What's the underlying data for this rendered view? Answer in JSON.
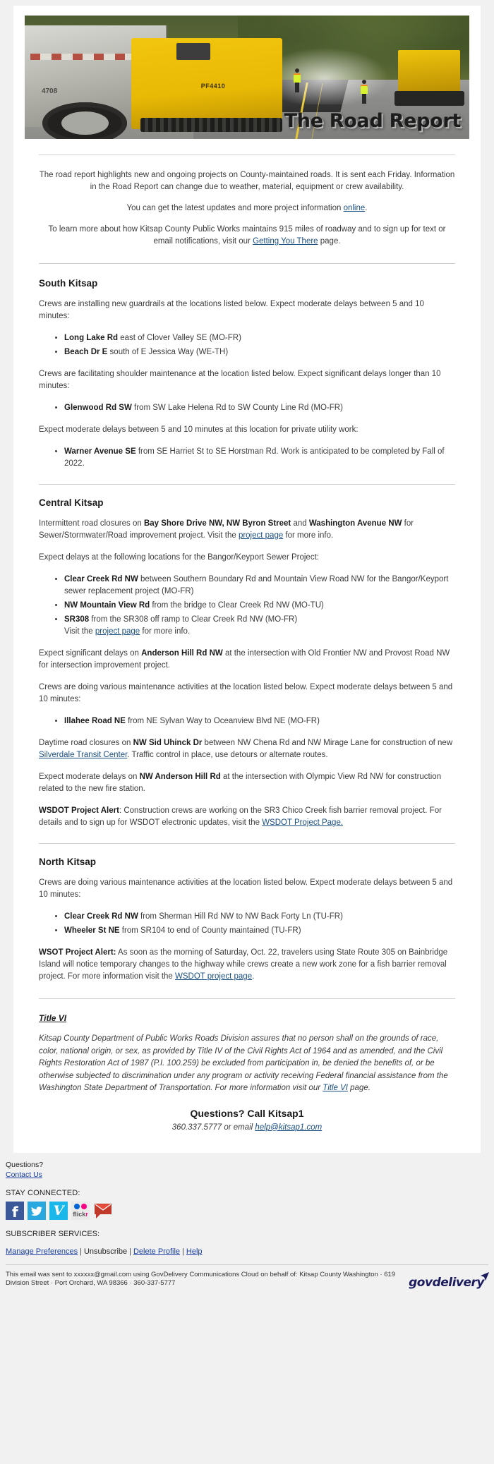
{
  "header": {
    "banner_title": "The Road Report",
    "paver_label": "PF4410",
    "truck_number": "4708"
  },
  "intro": {
    "line1": "The road report highlights new and ongoing projects on County-maintained roads. It is sent each Friday. Information in the Road Report can change due to weather, material, equipment or crew availability.",
    "line2_pre": "You can get the latest updates and more project information ",
    "line2_link": "online",
    "line2_post": ".",
    "line3_pre": "To learn more about how Kitsap County Public Works maintains 915 miles of roadway and to sign up for text or email notifications, visit our ",
    "line3_link": "Getting You There",
    "line3_post": " page."
  },
  "south_kitsap": {
    "heading": "South Kitsap",
    "p1": "Crews are installing new guardrails at the locations listed below. Expect moderate delays between 5 and 10 minutes:",
    "list1": [
      {
        "road": "Long Lake Rd",
        "rest": " east of Clover Valley SE (MO-FR)"
      },
      {
        "road": "Beach Dr E",
        "rest": " south of E Jessica Way (WE-TH)"
      }
    ],
    "p2": "Crews are facilitating shoulder maintenance at the location listed below. Expect significant delays longer than 10 minutes:",
    "list2": [
      {
        "road": "Glenwood Rd SW",
        "rest": " from SW Lake Helena Rd to SW County Line Rd (MO-FR)"
      }
    ],
    "p3": "Expect moderate delays between 5 and 10 minutes at this location for private utility work:",
    "list3": [
      {
        "road": "Warner Avenue SE",
        "rest": " from SE Harriet St to SE Horstman Rd. Work is anticipated to be completed by Fall of 2022."
      }
    ]
  },
  "central_kitsap": {
    "heading": "Central Kitsap",
    "p1_a": "Intermittent road closures on ",
    "p1_b1": "Bay Shore Drive NW, NW Byron Street",
    "p1_c": " and ",
    "p1_b2": "Washington Avenue NW",
    "p1_d": " for Sewer/Stormwater/Road improvement project. Visit the ",
    "p1_link": "project page",
    "p1_e": " for more info.",
    "p2": "Expect delays at the following locations for the Bangor/Keyport Sewer Project:",
    "list1": [
      {
        "road": "Clear Creek Rd NW",
        "rest": " between Southern Boundary Rd and Mountain View Road NW for the Bangor/Keyport sewer replacement project (MO-FR)"
      },
      {
        "road": "NW Mountain View Rd",
        "rest": " from the bridge to Clear Creek Rd NW (MO-TU)"
      },
      {
        "road": "SR308",
        "rest": " from the SR308 off ramp to Clear Creek Rd NW (MO-FR)"
      }
    ],
    "list1_sub_pre": "Visit the ",
    "list1_sub_link": "project page",
    "list1_sub_post": " for more info.",
    "p3_a": "Expect significant delays on ",
    "p3_b": "Anderson Hill Rd NW",
    "p3_c": " at the intersection with Old Frontier NW and Provost Road NW for intersection improvement project.",
    "p4": "Crews are doing various maintenance activities at the location listed below. Expect moderate delays between 5 and 10 minutes:",
    "list2": [
      {
        "road": "Illahee Road NE",
        "rest": " from NE Sylvan Way to Oceanview Blvd NE (MO-FR)"
      }
    ],
    "p5_a": "Daytime road closures on ",
    "p5_b": "NW Sid Uhinck Dr",
    "p5_c": " between NW Chena Rd and NW Mirage Lane for construction of new ",
    "p5_link": "Silverdale Transit Center",
    "p5_d": ".  Traffic control in place, use detours or alternate routes.",
    "p6_a": "Expect moderate delays on ",
    "p6_b": "NW Anderson Hill Rd",
    "p6_c": " at the intersection with Olympic View Rd NW for construction related to the new fire station.",
    "p7_label": "WSDOT Project Alert",
    "p7_a": ": Construction crews are working on the SR3 Chico Creek fish barrier removal project. For details and to sign up for WSDOT electronic updates, visit the ",
    "p7_link": "WSDOT Project Page."
  },
  "north_kitsap": {
    "heading": "North Kitsap",
    "p1": "Crews are doing various maintenance activities at the location listed below. Expect moderate delays between 5 and 10 minutes:",
    "list1": [
      {
        "road": "Clear Creek Rd NW",
        "rest": " from Sherman Hill Rd NW to NW Back Forty Ln (TU-FR)"
      },
      {
        "road": "Wheeler St NE",
        "rest": " from SR104 to end of County maintained (TU-FR)"
      }
    ],
    "p2_label": "WSOT Project Alert:",
    "p2_a": " As soon as the morning of Saturday, Oct. 22, travelers using State Route 305 on Bainbridge Island will notice temporary changes to the highway while crews create a new work zone for a fish barrier removal project. For more information visit the ",
    "p2_link": "WSDOT project page",
    "p2_b": "."
  },
  "title_vi": {
    "heading": "Title VI",
    "body_pre": "Kitsap County Department of Public Works Roads Division assures that no person shall on the grounds of race, color, national origin, or sex, as provided by Title IV of the Civil Rights Act of 1964 and as amended, and the Civil Rights Restoration Act of 1987 (P.I. 100.259) be excluded from participation in, be denied the benefits of, or be otherwise subjected to discrimination under any program or activity receiving Federal financial assistance from the Washington State Department of Transportation. For more information visit our ",
    "body_link": "Title VI",
    "body_post": " page.",
    "questions": "Questions? Call Kitsap1",
    "questions_pre": "360.337.5777 or email ",
    "questions_email": "help@kitsap1.com"
  },
  "footer": {
    "questions_label": "Questions?",
    "contact_link": "Contact Us",
    "stay_connected": "STAY CONNECTED:",
    "social": [
      {
        "name": "facebook",
        "label": "f"
      },
      {
        "name": "twitter",
        "label": ""
      },
      {
        "name": "vimeo",
        "label": "V"
      },
      {
        "name": "flickr",
        "label": "flickr"
      },
      {
        "name": "email",
        "label": ""
      }
    ],
    "subscriber_services": "SUBSCRIBER SERVICES:",
    "links": [
      "Manage Preferences",
      "Unsubscribe",
      "Delete Profile",
      "Help"
    ],
    "separator": "|",
    "legal": "This email was sent to xxxxxx@gmail.com using GovDelivery Communications Cloud on behalf of: Kitsap County Washington · 619 Division Street · Port Orchard, WA 98366 · 360-337-5777",
    "brand": "govdelivery"
  },
  "colors": {
    "link": "#1a4f82",
    "footer_link": "#1a3fa0",
    "page_bg": "#f1f1f1",
    "card_bg": "#ffffff",
    "accent_yellow": "#f2c50e"
  }
}
